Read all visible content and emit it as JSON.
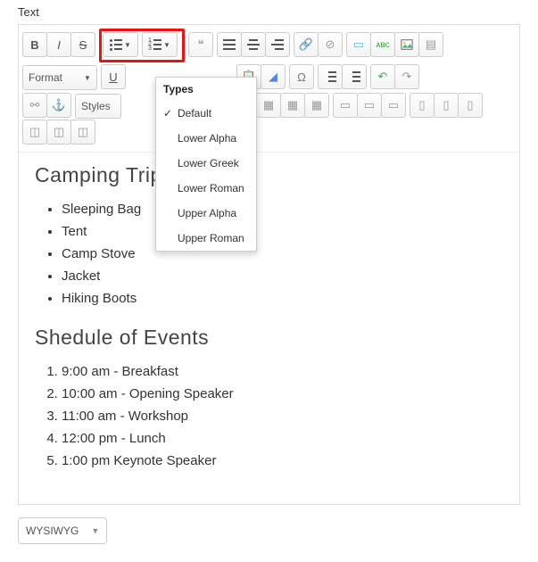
{
  "section_label": "Text",
  "toolbar": {
    "format_label": "Format",
    "styles_label": "Styles",
    "bold": "B",
    "italic": "I",
    "strike": "S",
    "underline": "U"
  },
  "dropdown": {
    "title": "Types",
    "items": [
      {
        "label": "Default",
        "checked": true
      },
      {
        "label": "Lower Alpha",
        "checked": false
      },
      {
        "label": "Lower Greek",
        "checked": false
      },
      {
        "label": "Lower Roman",
        "checked": false
      },
      {
        "label": "Upper Alpha",
        "checked": false
      },
      {
        "label": "Upper Roman",
        "checked": false
      }
    ]
  },
  "content": {
    "heading1": "Camping Trip",
    "bullet_list": [
      "Sleeping Bag",
      "Tent",
      "Camp Stove",
      "Jacket",
      "Hiking Boots"
    ],
    "heading2": "Shedule of Events",
    "numbered_list": [
      "9:00 am - Breakfast",
      "10:00 am - Opening Speaker",
      "11:00 am - Workshop",
      "12:00 pm - Lunch",
      "1:00 pm Keynote Speaker"
    ]
  },
  "footer": {
    "mode": "WYSIWYG"
  }
}
